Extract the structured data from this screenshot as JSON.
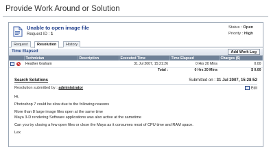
{
  "page": {
    "title": "Provide Work Around or Solution"
  },
  "issue": {
    "title": "Unable to open image file",
    "request_label": "Request ID :",
    "request_id": "1",
    "status_label": "Status :",
    "status": "Open",
    "priority_label": "Priority :",
    "priority": "High"
  },
  "tabs": [
    "Request",
    "Resolution",
    "History"
  ],
  "time": {
    "section_label": "Time Elapsed",
    "add_button": "Add Work Log",
    "columns": [
      "",
      "Technician",
      "Description",
      "Executed Time",
      "Time Elapsed",
      "Charges ($)"
    ],
    "rows": [
      {
        "technician": "Heather Graham",
        "description": "",
        "executed": "31 Jul 2007, 15:21:26",
        "elapsed": "0 Hrs 20 Mins",
        "charges": "0.00"
      }
    ],
    "total_label": "Total :",
    "total_elapsed": "0 Hrs 20 Mins",
    "total_charges": "$ 0.00"
  },
  "solution": {
    "search_link": "Search Solutions",
    "submitted_label": "Submitted on :",
    "submitted_on": "31 Jul 2007, 15:28:52",
    "resolution_by_label": "Resolution submitted by :",
    "resolution_by": "administrator",
    "edit_label": "Edit",
    "paragraphs": [
      "Hi,",
      "Photoshop 7 could be slow due to the following reasons",
      "More than 8 large image files open at the same time",
      "Maya 3-D rendering Software applications was also active at the sametime",
      "Can you try closing a few open files or close the Maya as it consumes most of CPU time and RAM space.",
      "Lex"
    ]
  }
}
